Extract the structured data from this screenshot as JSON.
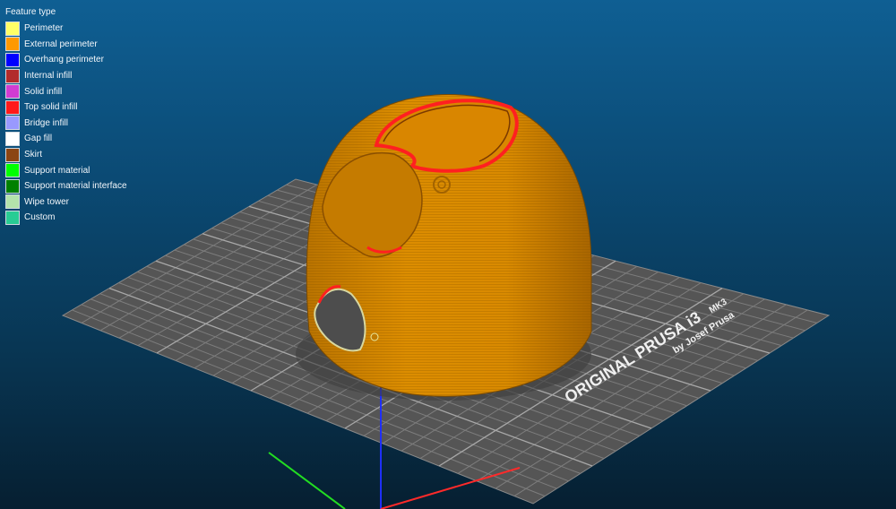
{
  "legend": {
    "title": "Feature type",
    "items": [
      {
        "label": "Perimeter",
        "color": "#ffff66"
      },
      {
        "label": "External perimeter",
        "color": "#ff9900"
      },
      {
        "label": "Overhang perimeter",
        "color": "#0000ff"
      },
      {
        "label": "Internal infill",
        "color": "#b22b2b"
      },
      {
        "label": "Solid infill",
        "color": "#d23cd2"
      },
      {
        "label": "Top solid infill",
        "color": "#ff1a1a"
      },
      {
        "label": "Bridge infill",
        "color": "#9999ff"
      },
      {
        "label": "Gap fill",
        "color": "#ffffff"
      },
      {
        "label": "Skirt",
        "color": "#8b4513"
      },
      {
        "label": "Support material",
        "color": "#00ff00"
      },
      {
        "label": "Support material interface",
        "color": "#008000"
      },
      {
        "label": "Wipe tower",
        "color": "#b3e3ab"
      },
      {
        "label": "Custom",
        "color": "#28cc94"
      }
    ]
  },
  "bed": {
    "brand_text": "ORIGINAL PRUSA i3",
    "model_text": "MK3",
    "credit_text": "by Josef Prusa"
  }
}
